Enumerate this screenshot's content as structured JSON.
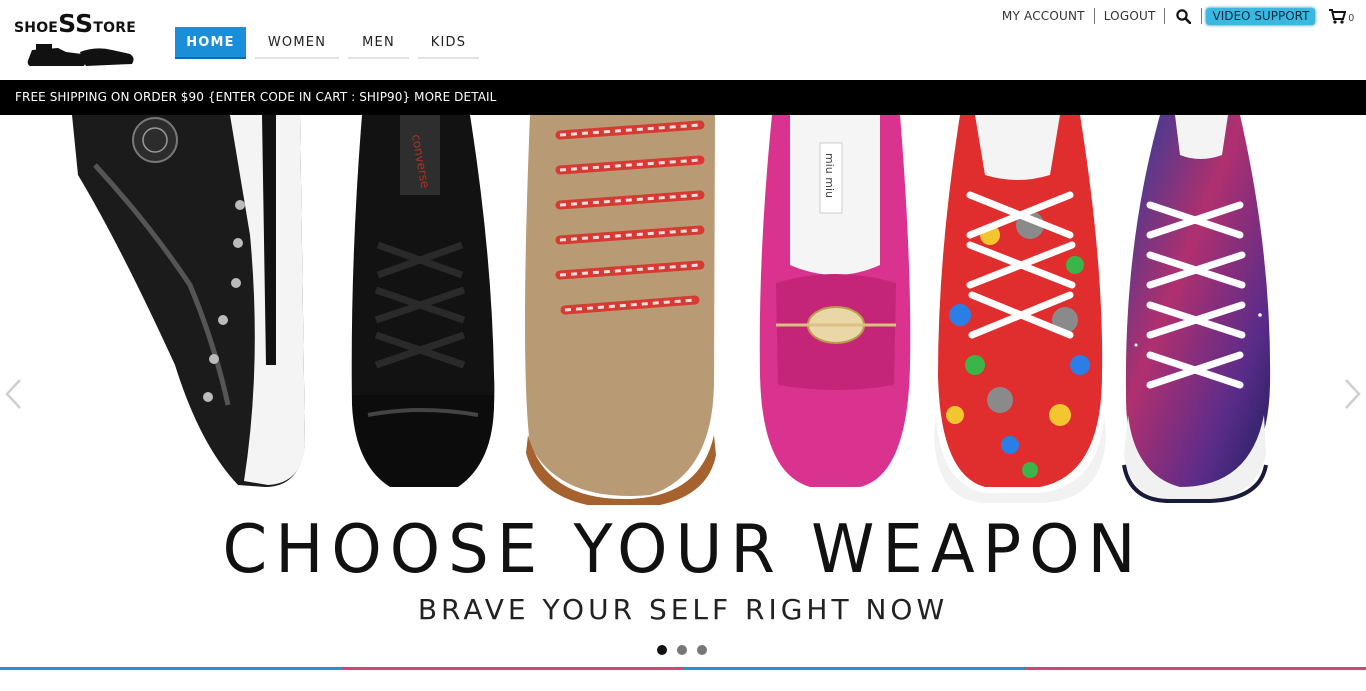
{
  "brand": {
    "logo_small_left": "SHOE",
    "logo_big": "SS",
    "logo_small_right": "TORE"
  },
  "nav": {
    "items": [
      {
        "label": "HOME",
        "active": true
      },
      {
        "label": "WOMEN",
        "active": false
      },
      {
        "label": "MEN",
        "active": false
      },
      {
        "label": "KIDS",
        "active": false
      }
    ]
  },
  "topbar": {
    "my_account": "MY ACCOUNT",
    "logout": "LOGOUT",
    "search_icon": "search-icon",
    "video_support": "VIDEO SUPPORT",
    "cart_icon": "cart-icon",
    "cart_count": "0"
  },
  "promo": {
    "text": "FREE SHIPPING ON ORDER $90 {ENTER CODE IN CART : SHIP90} MORE DETAIL"
  },
  "hero": {
    "headline": "CHOOSE YOUR WEAPON",
    "subline": "BRAVE YOUR SELF RIGHT NOW",
    "slides": 3,
    "active_slide": 1,
    "shoe_labels": [
      "converse",
      "miu miu"
    ]
  },
  "colors": {
    "accent": "#1a8ed8",
    "video_button": "#3bb8e0",
    "promo_bg": "#000000",
    "divider_blue": "#2196d6",
    "divider_pink": "#d34472"
  }
}
